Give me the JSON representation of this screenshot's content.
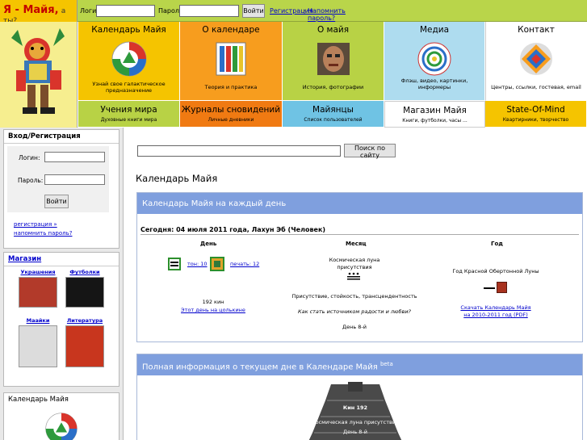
{
  "brand": {
    "title": "Я - Майя,",
    "tagline": "а ты?"
  },
  "topbar": {
    "login_label": "Логин:",
    "password_label": "Пароль:",
    "login_button": "Войти",
    "register_link": "Регистрация",
    "separator": "·",
    "remind_link": "Напомнить пароль?"
  },
  "nav": {
    "tiles": [
      {
        "title": "Календарь Майя",
        "subtitle": "Узнай свое галактическое предназначение",
        "color": "#f5c400"
      },
      {
        "title": "О календаре",
        "subtitle": "Теория и практика",
        "color": "#f79d1e"
      },
      {
        "title": "О майя",
        "subtitle": "История, фотографии",
        "color": "#b8d245"
      },
      {
        "title": "Медиа",
        "subtitle": "Флэш, видео, картинки, информеры",
        "color": "#aedcef"
      },
      {
        "title": "Контакт",
        "subtitle": "Центры, ссылки, гостевая, email",
        "color": "#ffffff"
      }
    ],
    "tiles2": [
      {
        "title": "Учения мира",
        "subtitle": "Духовные книги мира",
        "color": "#b8d245"
      },
      {
        "title": "Журналы сновидений",
        "subtitle": "Личные дневники",
        "color": "#f07a12"
      },
      {
        "title": "Майянцы",
        "subtitle": "Список пользователей",
        "color": "#6fc3e4"
      },
      {
        "title": "Магазин Майя",
        "subtitle": "Книги, футболки, часы ...",
        "color": "#ffffff"
      },
      {
        "title": "State-Of-Mind",
        "subtitle": "Квартирники, творчество",
        "color": "#f5c400"
      }
    ]
  },
  "sidebar": {
    "login_box": {
      "title": "Вход/Регистрация",
      "login_label": "Логин:",
      "password_label": "Пароль:",
      "button": "Войти",
      "register_link": "регистрация »",
      "remind_link": "напомнить пароль?"
    },
    "shop_box": {
      "title": "Магазин",
      "items": [
        {
          "label": "Украшения"
        },
        {
          "label": "Футболки"
        },
        {
          "label": "Маайки"
        },
        {
          "label": "Литература"
        }
      ]
    },
    "calendar_box": {
      "title": "Календарь Майя"
    }
  },
  "main": {
    "search_button": "Поиск по сайту",
    "page_title": "Календарь Майя",
    "panel1": {
      "title": "Календарь Майя на каждый день",
      "today": "Сегодня: 04 июля 2011 года, Лахун Эб (Человек)",
      "col_day": "День",
      "col_month": "Месяц",
      "col_year": "Год",
      "tone_link": "тон: 10",
      "seal_link": "печать: 12",
      "kin": "192 кин",
      "tzolkin_link": "Этот день на цолькине",
      "moon": "Космическая луна",
      "moon2": "присутствия",
      "month_words": "Присутствие, стойкость, трансцендентность",
      "question": "Как стать источником радости и любви?",
      "month_day": "День 8-й",
      "year": "Год Красной Обертонной Луны",
      "download1": "Скачать Календарь Майя",
      "download2": "на 2010-2011 год (PDF)"
    },
    "panel2": {
      "title": "Полная информация о текущем дне в Календаре Майя",
      "beta": "beta",
      "kin_label": "Кин 192",
      "moon_label": "Космическая луна присутствия",
      "day_label": "День 8-й"
    }
  }
}
